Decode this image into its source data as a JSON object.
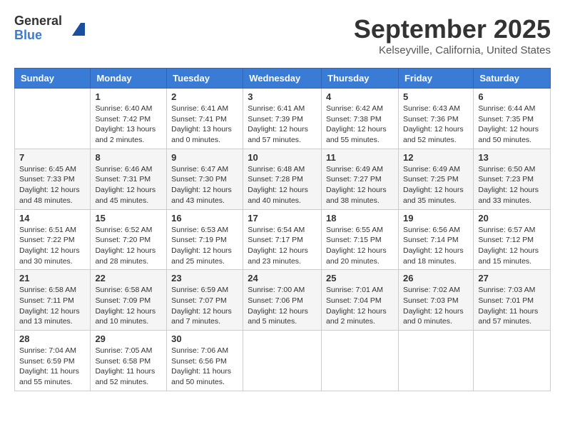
{
  "logo": {
    "general": "General",
    "blue": "Blue"
  },
  "title": "September 2025",
  "location": "Kelseyville, California, United States",
  "days_of_week": [
    "Sunday",
    "Monday",
    "Tuesday",
    "Wednesday",
    "Thursday",
    "Friday",
    "Saturday"
  ],
  "weeks": [
    [
      {
        "day": "",
        "info": ""
      },
      {
        "day": "1",
        "info": "Sunrise: 6:40 AM\nSunset: 7:42 PM\nDaylight: 13 hours\nand 2 minutes."
      },
      {
        "day": "2",
        "info": "Sunrise: 6:41 AM\nSunset: 7:41 PM\nDaylight: 13 hours\nand 0 minutes."
      },
      {
        "day": "3",
        "info": "Sunrise: 6:41 AM\nSunset: 7:39 PM\nDaylight: 12 hours\nand 57 minutes."
      },
      {
        "day": "4",
        "info": "Sunrise: 6:42 AM\nSunset: 7:38 PM\nDaylight: 12 hours\nand 55 minutes."
      },
      {
        "day": "5",
        "info": "Sunrise: 6:43 AM\nSunset: 7:36 PM\nDaylight: 12 hours\nand 52 minutes."
      },
      {
        "day": "6",
        "info": "Sunrise: 6:44 AM\nSunset: 7:35 PM\nDaylight: 12 hours\nand 50 minutes."
      }
    ],
    [
      {
        "day": "7",
        "info": "Sunrise: 6:45 AM\nSunset: 7:33 PM\nDaylight: 12 hours\nand 48 minutes."
      },
      {
        "day": "8",
        "info": "Sunrise: 6:46 AM\nSunset: 7:31 PM\nDaylight: 12 hours\nand 45 minutes."
      },
      {
        "day": "9",
        "info": "Sunrise: 6:47 AM\nSunset: 7:30 PM\nDaylight: 12 hours\nand 43 minutes."
      },
      {
        "day": "10",
        "info": "Sunrise: 6:48 AM\nSunset: 7:28 PM\nDaylight: 12 hours\nand 40 minutes."
      },
      {
        "day": "11",
        "info": "Sunrise: 6:49 AM\nSunset: 7:27 PM\nDaylight: 12 hours\nand 38 minutes."
      },
      {
        "day": "12",
        "info": "Sunrise: 6:49 AM\nSunset: 7:25 PM\nDaylight: 12 hours\nand 35 minutes."
      },
      {
        "day": "13",
        "info": "Sunrise: 6:50 AM\nSunset: 7:23 PM\nDaylight: 12 hours\nand 33 minutes."
      }
    ],
    [
      {
        "day": "14",
        "info": "Sunrise: 6:51 AM\nSunset: 7:22 PM\nDaylight: 12 hours\nand 30 minutes."
      },
      {
        "day": "15",
        "info": "Sunrise: 6:52 AM\nSunset: 7:20 PM\nDaylight: 12 hours\nand 28 minutes."
      },
      {
        "day": "16",
        "info": "Sunrise: 6:53 AM\nSunset: 7:19 PM\nDaylight: 12 hours\nand 25 minutes."
      },
      {
        "day": "17",
        "info": "Sunrise: 6:54 AM\nSunset: 7:17 PM\nDaylight: 12 hours\nand 23 minutes."
      },
      {
        "day": "18",
        "info": "Sunrise: 6:55 AM\nSunset: 7:15 PM\nDaylight: 12 hours\nand 20 minutes."
      },
      {
        "day": "19",
        "info": "Sunrise: 6:56 AM\nSunset: 7:14 PM\nDaylight: 12 hours\nand 18 minutes."
      },
      {
        "day": "20",
        "info": "Sunrise: 6:57 AM\nSunset: 7:12 PM\nDaylight: 12 hours\nand 15 minutes."
      }
    ],
    [
      {
        "day": "21",
        "info": "Sunrise: 6:58 AM\nSunset: 7:11 PM\nDaylight: 12 hours\nand 13 minutes."
      },
      {
        "day": "22",
        "info": "Sunrise: 6:58 AM\nSunset: 7:09 PM\nDaylight: 12 hours\nand 10 minutes."
      },
      {
        "day": "23",
        "info": "Sunrise: 6:59 AM\nSunset: 7:07 PM\nDaylight: 12 hours\nand 7 minutes."
      },
      {
        "day": "24",
        "info": "Sunrise: 7:00 AM\nSunset: 7:06 PM\nDaylight: 12 hours\nand 5 minutes."
      },
      {
        "day": "25",
        "info": "Sunrise: 7:01 AM\nSunset: 7:04 PM\nDaylight: 12 hours\nand 2 minutes."
      },
      {
        "day": "26",
        "info": "Sunrise: 7:02 AM\nSunset: 7:03 PM\nDaylight: 12 hours\nand 0 minutes."
      },
      {
        "day": "27",
        "info": "Sunrise: 7:03 AM\nSunset: 7:01 PM\nDaylight: 11 hours\nand 57 minutes."
      }
    ],
    [
      {
        "day": "28",
        "info": "Sunrise: 7:04 AM\nSunset: 6:59 PM\nDaylight: 11 hours\nand 55 minutes."
      },
      {
        "day": "29",
        "info": "Sunrise: 7:05 AM\nSunset: 6:58 PM\nDaylight: 11 hours\nand 52 minutes."
      },
      {
        "day": "30",
        "info": "Sunrise: 7:06 AM\nSunset: 6:56 PM\nDaylight: 11 hours\nand 50 minutes."
      },
      {
        "day": "",
        "info": ""
      },
      {
        "day": "",
        "info": ""
      },
      {
        "day": "",
        "info": ""
      },
      {
        "day": "",
        "info": ""
      }
    ]
  ]
}
